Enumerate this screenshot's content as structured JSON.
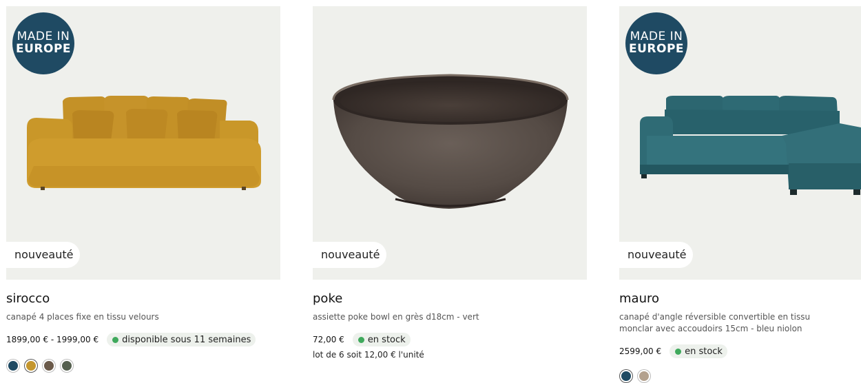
{
  "products": [
    {
      "made_in_line1": "MADE IN",
      "made_in_line2": "EUROPE",
      "badge": "nouveauté",
      "title": "sirocco",
      "description": "canapé 4 places fixe en tissu velours",
      "price": "1899,00 € - 1999,00 €",
      "availability": "disponible sous 11 semaines",
      "swatches": [
        "#1f4a63",
        "#c5972f",
        "#6b5a4a",
        "#55604f"
      ],
      "selected_swatch": 1,
      "image_icon": "sofa-image"
    },
    {
      "badge": "nouveauté",
      "title": "poke",
      "description": "assiette poke bowl en grès d18cm - vert",
      "price": "72,00 €",
      "availability": "en stock",
      "lot": "lot de 6 soit 12,00 € l'unité",
      "image_icon": "bowl-image"
    },
    {
      "made_in_line1": "MADE IN",
      "made_in_line2": "EUROPE",
      "badge": "nouveauté",
      "title": "mauro",
      "description_line1": "canapé d'angle réversible convertible en tissu",
      "description_line2": "monclar avec accoudoirs 15cm - bleu niolon",
      "price": "2599,00 €",
      "availability": "en stock",
      "swatches": [
        "#1f4a63",
        "#b3a18e"
      ],
      "selected_swatch": 0,
      "image_icon": "corner-sofa-image"
    }
  ],
  "colors": {
    "badge_blue": "#1f4a63",
    "stock_green": "#3fa95c",
    "image_background": "#eff0ec"
  }
}
